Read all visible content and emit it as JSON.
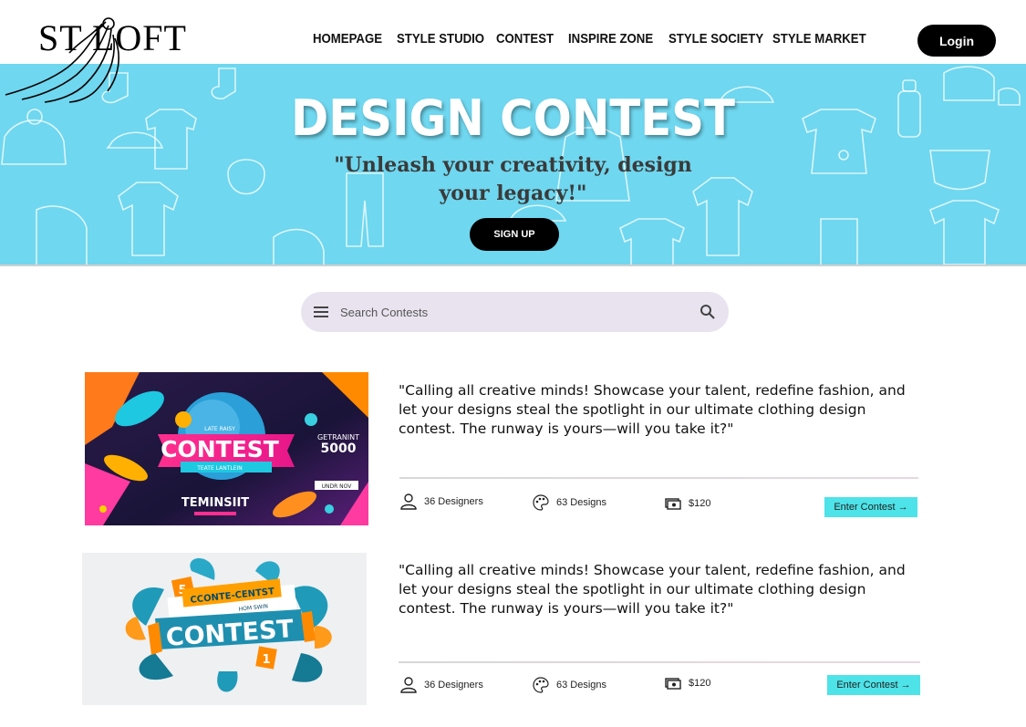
{
  "brand": {
    "logo_text": "ST LOFT"
  },
  "nav": {
    "items": [
      {
        "label": "HOMEPAGE"
      },
      {
        "label": "STYLE STUDIO"
      },
      {
        "label": "CONTEST"
      },
      {
        "label": "INSPIRE ZONE"
      },
      {
        "label": "STYLE SOCIETY"
      },
      {
        "label": "STYLE MARKET"
      }
    ],
    "login_label": "Login"
  },
  "hero": {
    "title": "DESIGN CONTEST",
    "tagline": "\"Unleash your creativity, design your legacy!\"",
    "signup_label": "SIGN UP",
    "background_color": "#6fd7ef"
  },
  "search": {
    "placeholder": "Search Contests",
    "value": ""
  },
  "contests": [
    {
      "image": {
        "banner_text": "CONTEST",
        "sub_text": "TEMINSIIT",
        "side_text": "GETRANINT",
        "side_number": "5000",
        "small_text": "LATE RAISY",
        "ribbon_text": "TEATE LANTLEIN",
        "button_text": "UNDR NOV"
      },
      "description": "\"Calling all creative minds! Showcase your talent, redefine fashion, and let your designs steal the spotlight in our ultimate clothing design contest. The runway is yours—will you take it?\"",
      "designers": "36 Designers",
      "designs": "63 Designs",
      "prize": "$120",
      "enter_label": "Enter Contest →"
    },
    {
      "image": {
        "banner_text": "CONTEST",
        "sub_text": "CCONTE-CENTST",
        "small_text": "HOM SWIN",
        "tag_number": "5",
        "tag_number_2": "1"
      },
      "description": "\"Calling all creative minds! Showcase your talent, redefine fashion, and let your designs steal the spotlight in our ultimate clothing design contest. The runway is yours—will you take it?\"",
      "designers": "36 Designers",
      "designs": "63 Designs",
      "prize": "$120",
      "enter_label": "Enter Contest →"
    }
  ],
  "colors": {
    "accent_cyan": "#4de3e8",
    "dark": "#000000",
    "search_bg": "#e9e3ef"
  }
}
